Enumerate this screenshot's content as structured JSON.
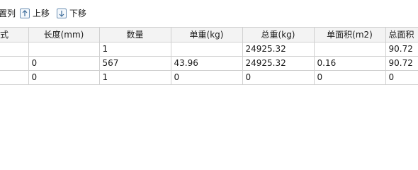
{
  "toolbar": {
    "set_columns_label": "置列",
    "move_up_label": "上移",
    "move_down_label": "下移",
    "move_up_icon": "arrow-up-icon",
    "move_down_icon": "arrow-down-icon"
  },
  "table": {
    "columns": [
      "式",
      "长度(mm)",
      "数量",
      "单重(kg)",
      "总重(kg)",
      "单面积(m2)",
      "总面积"
    ],
    "rows": [
      [
        "",
        "",
        "1",
        "",
        "24925.32",
        "",
        "90.72"
      ],
      [
        "",
        "0",
        "567",
        "43.96",
        "24925.32",
        "0.16",
        "90.72"
      ],
      [
        "",
        "0",
        "1",
        "0",
        "0",
        "0",
        "0"
      ]
    ]
  },
  "colors": {
    "header_bg": "#f3f3f3",
    "grid_line": "#d0d0d0",
    "icon_border": "#6b8fb3"
  }
}
